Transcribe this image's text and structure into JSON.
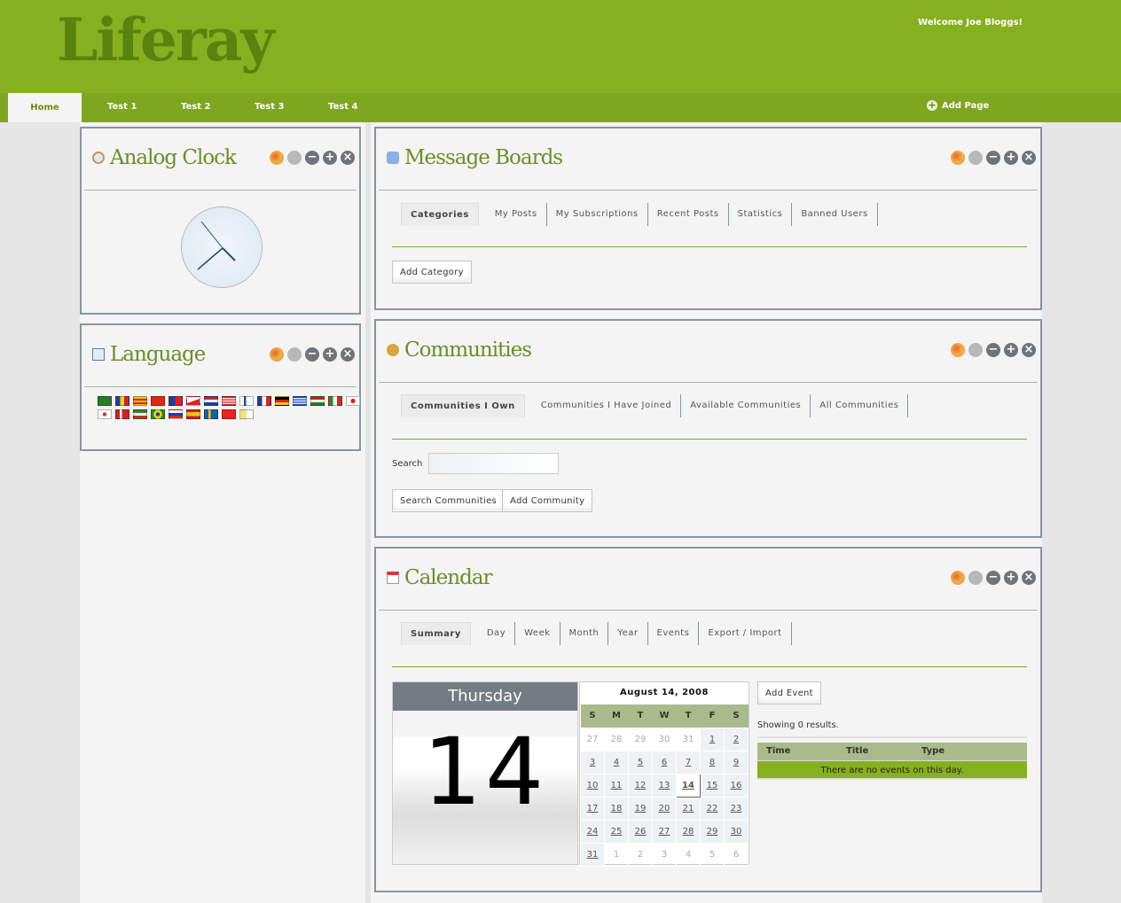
{
  "header": {
    "logo": "Liferay",
    "welcome": "Welcome Joe Bloggs!"
  },
  "nav": {
    "tabs": [
      "Home",
      "Test 1",
      "Test 2",
      "Test 3",
      "Test 4"
    ],
    "add_page": "Add Page"
  },
  "portlets": {
    "clock": {
      "title": "Analog Clock",
      "icon": "clock-icon",
      "time": "7:50"
    },
    "language": {
      "title": "Language",
      "icon": "language-icon",
      "flags": [
        "saudi-arabia",
        "andorra",
        "catalonia",
        "china",
        "taiwan",
        "czech",
        "netherlands",
        "usa",
        "finland",
        "france",
        "germany",
        "greece",
        "hungary",
        "italy",
        "japan",
        "korea",
        "norway",
        "iran",
        "brazil",
        "russia",
        "spain",
        "sweden",
        "turkey",
        "vatican"
      ]
    },
    "message_boards": {
      "title": "Message Boards",
      "icon": "message-boards-icon",
      "tabs": [
        "Categories",
        "My Posts",
        "My Subscriptions",
        "Recent Posts",
        "Statistics",
        "Banned Users"
      ],
      "add_button": "Add Category"
    },
    "communities": {
      "title": "Communities",
      "icon": "communities-icon",
      "tabs": [
        "Communities I Own",
        "Communities I Have Joined",
        "Available Communities",
        "All Communities"
      ],
      "search_label": "Search",
      "search_value": "",
      "search_button": "Search Communities",
      "add_button": "Add Community"
    },
    "calendar": {
      "title": "Calendar",
      "icon": "calendar-icon",
      "tabs": [
        "Summary",
        "Day",
        "Week",
        "Month",
        "Year",
        "Events",
        "Export / Import"
      ],
      "day_name": "Thursday",
      "day_number": "14",
      "month_title": "August 14, 2008",
      "weekdays": [
        "S",
        "M",
        "T",
        "W",
        "T",
        "F",
        "S"
      ],
      "weeks": [
        [
          "27",
          "28",
          "29",
          "30",
          "31",
          "1",
          "2"
        ],
        [
          "3",
          "4",
          "5",
          "6",
          "7",
          "8",
          "9"
        ],
        [
          "10",
          "11",
          "12",
          "13",
          "14",
          "15",
          "16"
        ],
        [
          "17",
          "18",
          "19",
          "20",
          "21",
          "22",
          "23"
        ],
        [
          "24",
          "25",
          "26",
          "27",
          "28",
          "29",
          "30"
        ],
        [
          "31",
          "1",
          "2",
          "3",
          "4",
          "5",
          "6"
        ]
      ],
      "add_event": "Add Event",
      "showing": "Showing 0 results.",
      "columns": [
        "Time",
        "Title",
        "Type"
      ],
      "empty": "There are no events on this day."
    }
  },
  "colors": {
    "header": "#86b01f",
    "nav": "#7ea61f",
    "title": "#6b8e2a"
  }
}
